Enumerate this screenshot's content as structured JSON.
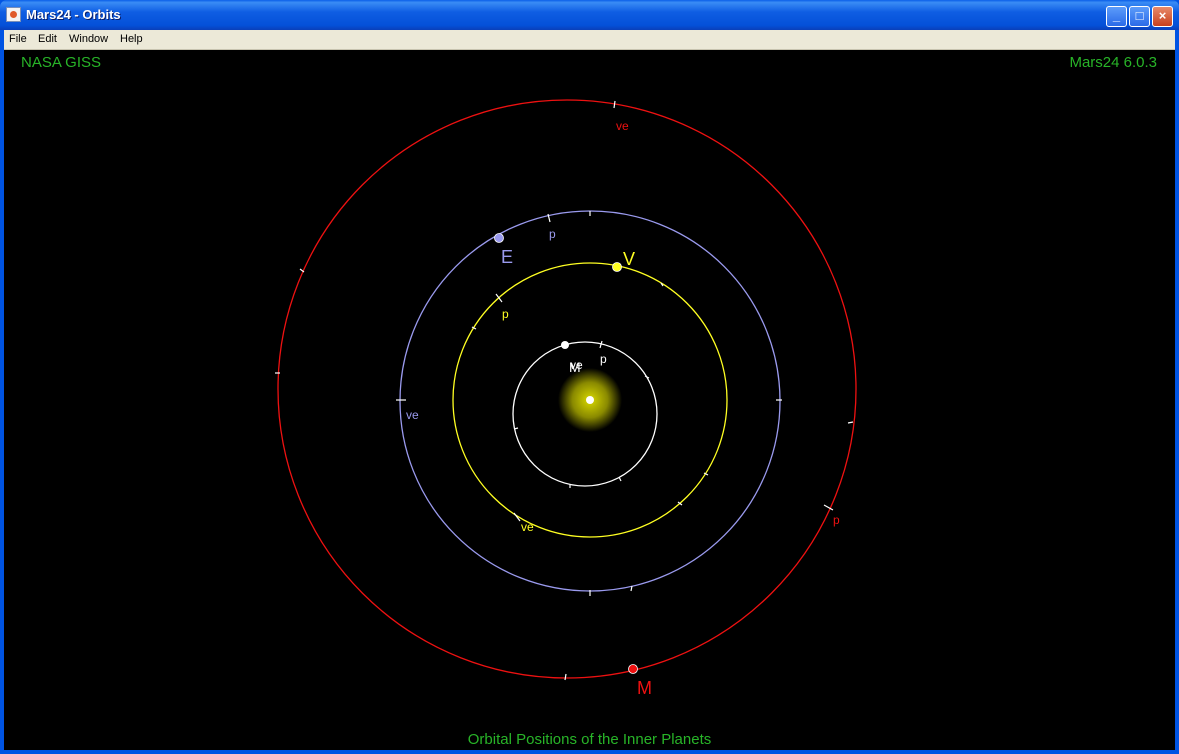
{
  "window": {
    "title": "Mars24 - Orbits",
    "controls": {
      "minimize": "_",
      "maximize": "□",
      "close": "×"
    }
  },
  "menu": [
    "File",
    "Edit",
    "Window",
    "Help"
  ],
  "canvas": {
    "top_left_label": "NASA GISS",
    "top_right_label": "Mars24 6.0.3",
    "bottom_label": "Orbital Positions of the Inner Planets",
    "background": "#000000",
    "label_color": "#28b428"
  },
  "orbits": [
    {
      "planet": "Mercury",
      "color": "#ffffff",
      "planet_label": "M",
      "markers": [
        {
          "text": "p"
        },
        {
          "text": "ve"
        }
      ]
    },
    {
      "planet": "Venus",
      "color": "#ffff22",
      "planet_label": "V",
      "markers": [
        {
          "text": "p"
        },
        {
          "text": "ve"
        }
      ]
    },
    {
      "planet": "Earth",
      "color": "#9a9aee",
      "planet_label": "E",
      "markers": [
        {
          "text": "p"
        },
        {
          "text": "ve"
        }
      ]
    },
    {
      "planet": "Mars",
      "color": "#ee1111",
      "planet_label": "M",
      "markers": [
        {
          "text": "ve"
        },
        {
          "text": "p"
        }
      ]
    }
  ],
  "sun": {
    "glow_color": "#bfbf00",
    "core_color": "#ffffff"
  }
}
